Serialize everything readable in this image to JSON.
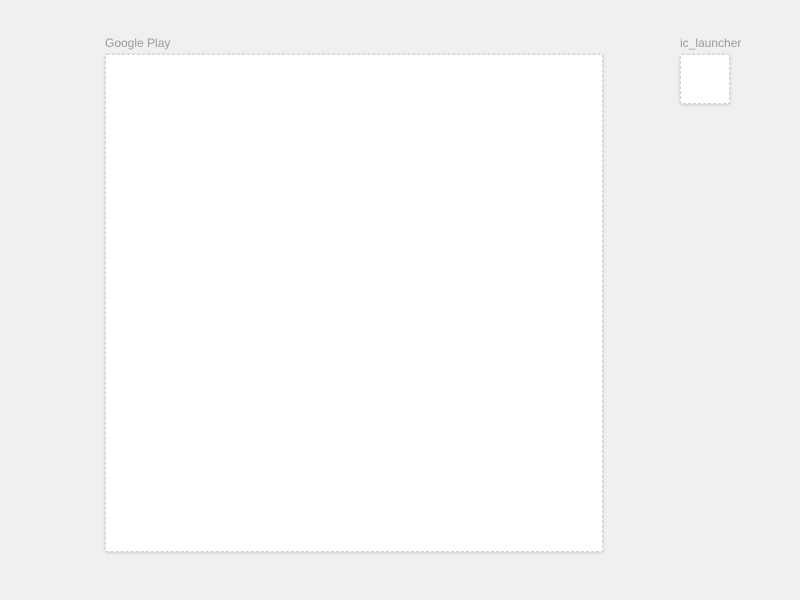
{
  "assets": {
    "feature": {
      "label": "Google Play"
    },
    "icon": {
      "label": "ic_launcher"
    }
  }
}
